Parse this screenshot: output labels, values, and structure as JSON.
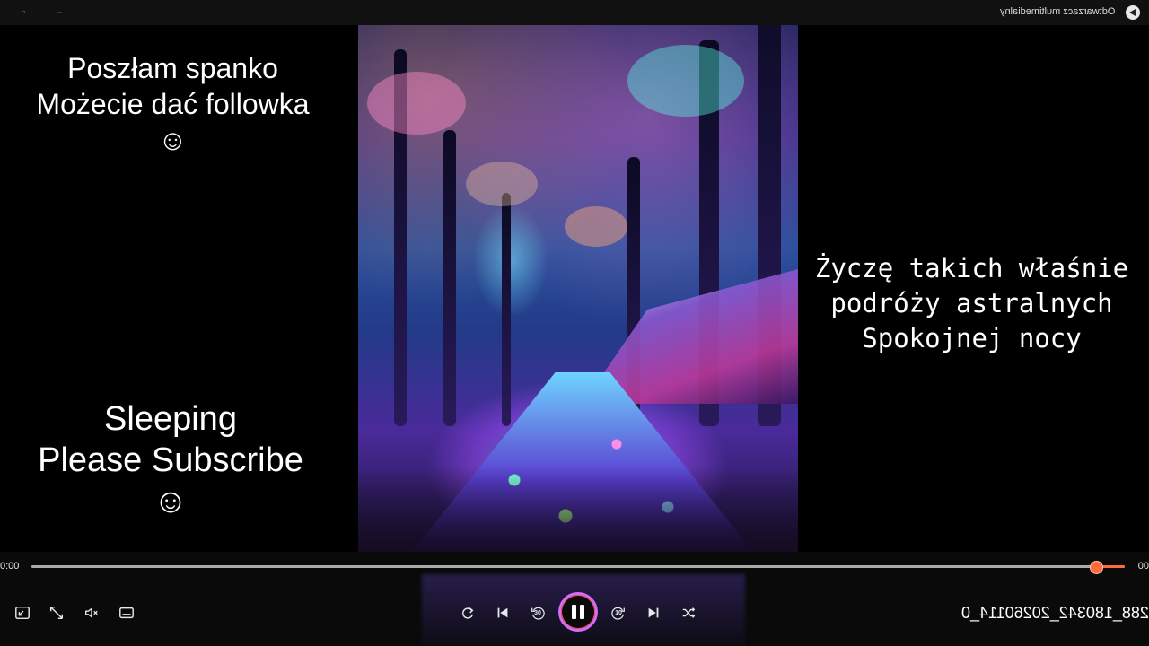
{
  "window": {
    "title": "Odtwarzacz multimedialny",
    "icon": "media-player-icon",
    "buttons": [
      "restore-icon",
      "minimize-icon"
    ]
  },
  "overlays": {
    "polish_left": [
      "Poszłam spanko",
      "Możecie dać followka",
      "☺"
    ],
    "english_left": [
      "Sleeping",
      "Please Subscribe",
      "☺"
    ],
    "polish_right": [
      "Życzę takich właśnie",
      "podróży astralnych",
      "Spokojnej nocy"
    ]
  },
  "playback": {
    "time_elapsed": "0:00",
    "time_remaining": "00",
    "progress_fraction": 0.973,
    "state": "playing",
    "skip_back_label": "30",
    "skip_forward_label": "10",
    "filename": "288_180342_20260114_0"
  },
  "colors": {
    "accent": "#ff6a3d",
    "accent_ring": "#d46bff",
    "background": "#000000"
  },
  "controls_left": [
    "mini-player-icon",
    "fullscreen-icon",
    "volume-icon",
    "subtitles-icon"
  ],
  "controls_center": [
    "repeat-icon",
    "previous-icon",
    "skip-back-icon",
    "pause-icon",
    "skip-forward-icon",
    "next-icon",
    "shuffle-icon"
  ]
}
